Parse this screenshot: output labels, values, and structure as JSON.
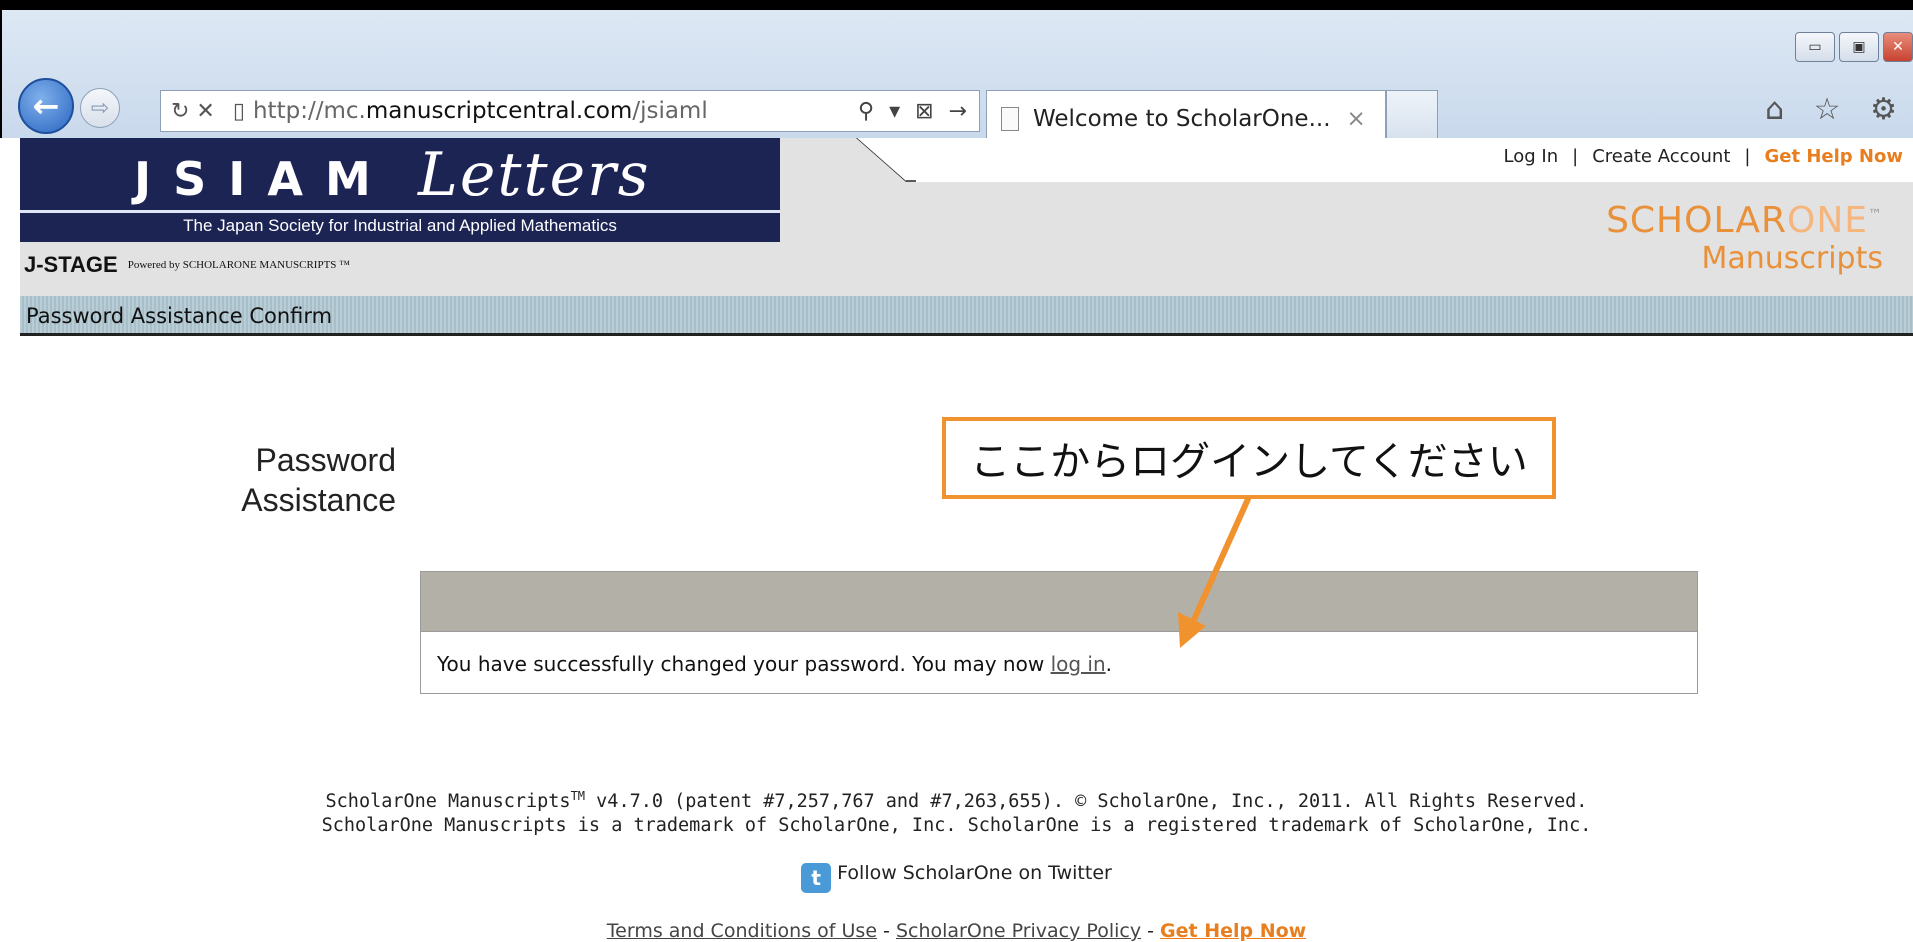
{
  "browser": {
    "url_prefix": "http://mc.",
    "url_domain": "manuscriptcentral.com",
    "url_path": "/jsiaml",
    "tab_title": "Welcome to ScholarOne...",
    "tab_close": "×",
    "min_glyph": "▭",
    "max_glyph": "▣",
    "close_glyph": "✕",
    "back_glyph": "←",
    "fwd_glyph": "⇨",
    "reload_stop": "↻ ✕",
    "addr_tools": "⚲ ▾ ⊠ →",
    "fav_glyphs": "⌂ ☆ ⚙"
  },
  "site": {
    "banner_jsiam": "JSIAM",
    "banner_letters": "Letters",
    "banner_sub": "The Japan Society for Industrial and Applied Mathematics",
    "jstage": "J-STAGE",
    "powered": "Powered by SCHOLARONE MANUSCRIPTS ™",
    "links": {
      "login": "Log In",
      "sep": "|",
      "create": "Create Account",
      "help": "Get Help Now"
    },
    "logo_a1": "SCHOLAR",
    "logo_a2": "ONE",
    "logo_tm": "™",
    "logo_b": "Manuscripts",
    "page_bar": "Password Assistance Confirm"
  },
  "main": {
    "title_line1": "Password",
    "title_line2": "Assistance",
    "message_pre": "You have successfully changed your password. You may now ",
    "message_link": "log in",
    "message_post": ".",
    "callout": "ここからログインしてください"
  },
  "footer": {
    "line1_a": "ScholarOne Manuscripts",
    "line1_tm": "TM",
    "line1_b": " v4.7.0 (patent #7,257,767 and #7,263,655). © ScholarOne, Inc., 2011. All Rights Reserved.",
    "line2": "ScholarOne Manuscripts is a trademark of ScholarOne, Inc. ScholarOne is a registered trademark of ScholarOne, Inc.",
    "twitter": "Follow ScholarOne on Twitter",
    "terms": "Terms and Conditions of Use",
    "dash": " - ",
    "privacy": "ScholarOne Privacy Policy",
    "help": "Get Help Now"
  },
  "colors": {
    "accent_orange": "#e87e1e",
    "banner_navy": "#1c2454",
    "callout_border": "#f0922e"
  }
}
